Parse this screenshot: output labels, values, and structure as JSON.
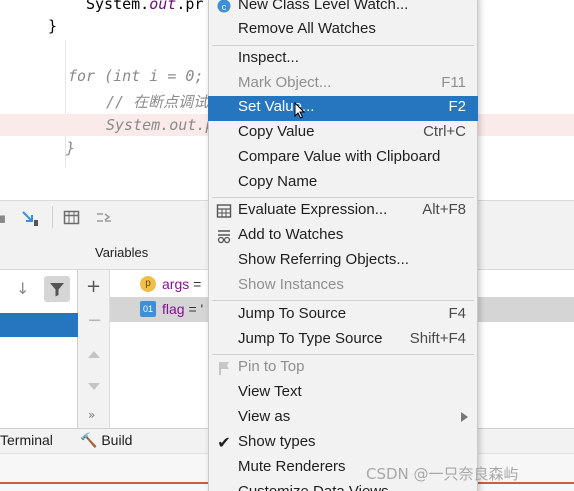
{
  "editor": {
    "line1_prefix": "System.",
    "line1_field": "out",
    "line1_suffix": ".pr",
    "brace_close": "}",
    "for_keyword": "for",
    "for_paren": " (",
    "int_keyword": "int",
    "for_rest": " i = ",
    "for_zero": "0",
    "for_semicolon": ";",
    "comment": "// 在断点调试",
    "line_sysout_prefix": "System.",
    "line_sysout_field": "out",
    "line_sysout_suffix": ".p",
    "brace_close2": "}"
  },
  "debug": {
    "variables_title": "Variables",
    "vars": [
      {
        "badge": "p",
        "name": "args",
        "eq": " ="
      },
      {
        "badge": "01",
        "name": "flag",
        "eq": " = '"
      }
    ],
    "bottom_tabs": {
      "terminal": "Terminal",
      "build": "Build"
    }
  },
  "context_menu": {
    "items": [
      {
        "label": "New Class Level Watch...",
        "shortcut": "",
        "icon": "watch-icon",
        "disabled": false
      },
      {
        "label": "Remove All Watches",
        "shortcut": "",
        "icon": "",
        "disabled": false
      },
      {
        "label": "Inspect...",
        "shortcut": "",
        "icon": "",
        "disabled": false
      },
      {
        "label": "Mark Object...",
        "shortcut": "F11",
        "icon": "",
        "disabled": true
      },
      {
        "label": "Set Value...",
        "shortcut": "F2",
        "icon": "",
        "disabled": false
      },
      {
        "label": "Copy Value",
        "shortcut": "Ctrl+C",
        "icon": "",
        "disabled": false
      },
      {
        "label": "Compare Value with Clipboard",
        "shortcut": "",
        "icon": "",
        "disabled": false
      },
      {
        "label": "Copy Name",
        "shortcut": "",
        "icon": "",
        "disabled": false
      },
      {
        "label": "Evaluate Expression...",
        "shortcut": "Alt+F8",
        "icon": "calculator-icon",
        "disabled": false
      },
      {
        "label": "Add to Watches",
        "shortcut": "",
        "icon": "watches-icon",
        "disabled": false
      },
      {
        "label": "Show Referring Objects...",
        "shortcut": "",
        "icon": "",
        "disabled": false
      },
      {
        "label": "Show Instances",
        "shortcut": "",
        "icon": "",
        "disabled": true
      },
      {
        "label": "Jump To Source",
        "shortcut": "F4",
        "icon": "",
        "disabled": false
      },
      {
        "label": "Jump To Type Source",
        "shortcut": "Shift+F4",
        "icon": "",
        "disabled": false
      },
      {
        "label": "Pin to Top",
        "shortcut": "",
        "icon": "pin-icon",
        "disabled": true
      },
      {
        "label": "View Text",
        "shortcut": "",
        "icon": "",
        "disabled": false
      },
      {
        "label": "View as",
        "shortcut": "",
        "icon": "",
        "disabled": false
      },
      {
        "label": "Show types",
        "shortcut": "",
        "icon": "check-icon",
        "disabled": false
      },
      {
        "label": "Mute Renderers",
        "shortcut": "",
        "icon": "",
        "disabled": false
      },
      {
        "label": "Customize Data Views...",
        "shortcut": "",
        "icon": "",
        "disabled": false
      }
    ],
    "highlighted": "Set Value..."
  },
  "watermark": "CSDN @一只奈良森屿",
  "colors": {
    "selection": "#2675bf",
    "breakpoint_line": "#faeaea",
    "menu_bg": "#f2f2f2"
  }
}
